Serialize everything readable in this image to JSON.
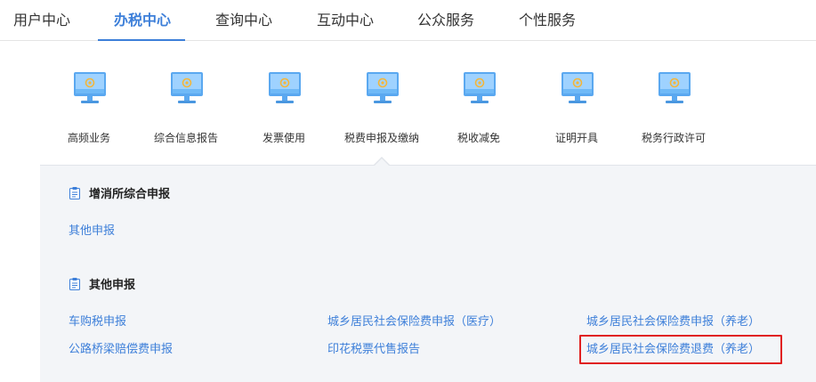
{
  "topnav": {
    "tabs": [
      {
        "label": "用户中心"
      },
      {
        "label": "办税中心",
        "active": true
      },
      {
        "label": "查询中心"
      },
      {
        "label": "互动中心"
      },
      {
        "label": "公众服务"
      },
      {
        "label": "个性服务"
      }
    ]
  },
  "iconrow": {
    "icon": "monitor-icon",
    "items": [
      {
        "label": "高频业务"
      },
      {
        "label": "综合信息报告"
      },
      {
        "label": "发票使用"
      },
      {
        "label": "税费申报及缴纳",
        "selected": true
      },
      {
        "label": "税收减免"
      },
      {
        "label": "证明开具"
      },
      {
        "label": "税务行政许可"
      }
    ]
  },
  "panel": {
    "sections": [
      {
        "title": "增消所综合申报",
        "icon": "document-icon",
        "links": [
          {
            "label": "其他申报"
          }
        ]
      },
      {
        "title": "其他申报",
        "icon": "document-icon",
        "links": [
          {
            "label": "车购税申报"
          },
          {
            "label": "城乡居民社会保险费申报（医疗）"
          },
          {
            "label": "城乡居民社会保险费申报（养老）"
          },
          {
            "label": "公路桥梁赔偿费申报"
          },
          {
            "label": "印花税票代售报告"
          },
          {
            "label": "城乡居民社会保险费退费（养老）",
            "highlighted": true
          }
        ]
      }
    ]
  },
  "colors": {
    "accent": "#3d7fd9",
    "highlight": "#e02020",
    "panel_bg": "#f3f5f8"
  }
}
